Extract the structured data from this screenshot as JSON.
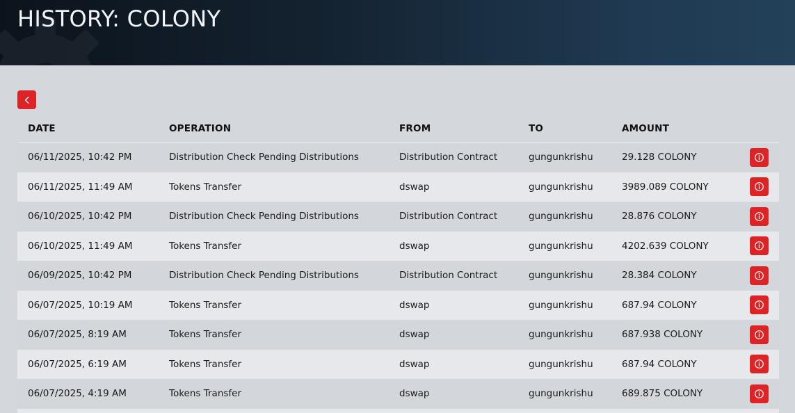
{
  "header": {
    "title": "HISTORY: COLONY"
  },
  "icons": {
    "back": "chevron-left-icon",
    "info": "info-circle-icon",
    "decor": "gear-icon"
  },
  "colors": {
    "accent": "#de2326",
    "header_dark": "#0c131b",
    "header_light": "#234159"
  },
  "table": {
    "columns": [
      "DATE",
      "OPERATION",
      "FROM",
      "TO",
      "AMOUNT"
    ],
    "rows": [
      {
        "date": "06/11/2025, 10:42 PM",
        "operation": "Distribution Check Pending Distributions",
        "from": "Distribution Contract",
        "to": "gungunkrishu",
        "amount": "29.128 COLONY"
      },
      {
        "date": "06/11/2025, 11:49 AM",
        "operation": "Tokens Transfer",
        "from": "dswap",
        "to": "gungunkrishu",
        "amount": "3989.089 COLONY"
      },
      {
        "date": "06/10/2025, 10:42 PM",
        "operation": "Distribution Check Pending Distributions",
        "from": "Distribution Contract",
        "to": "gungunkrishu",
        "amount": "28.876 COLONY"
      },
      {
        "date": "06/10/2025, 11:49 AM",
        "operation": "Tokens Transfer",
        "from": "dswap",
        "to": "gungunkrishu",
        "amount": "4202.639 COLONY"
      },
      {
        "date": "06/09/2025, 10:42 PM",
        "operation": "Distribution Check Pending Distributions",
        "from": "Distribution Contract",
        "to": "gungunkrishu",
        "amount": "28.384 COLONY"
      },
      {
        "date": "06/07/2025, 10:19 AM",
        "operation": "Tokens Transfer",
        "from": "dswap",
        "to": "gungunkrishu",
        "amount": "687.94 COLONY"
      },
      {
        "date": "06/07/2025, 8:19 AM",
        "operation": "Tokens Transfer",
        "from": "dswap",
        "to": "gungunkrishu",
        "amount": "687.938 COLONY"
      },
      {
        "date": "06/07/2025, 6:19 AM",
        "operation": "Tokens Transfer",
        "from": "dswap",
        "to": "gungunkrishu",
        "amount": "687.94 COLONY"
      },
      {
        "date": "06/07/2025, 4:19 AM",
        "operation": "Tokens Transfer",
        "from": "dswap",
        "to": "gungunkrishu",
        "amount": "689.875 COLONY"
      }
    ]
  }
}
